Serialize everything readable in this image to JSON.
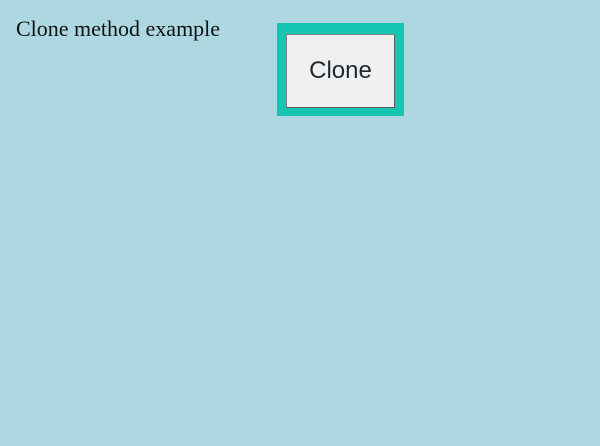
{
  "page": {
    "text": "Clone method example",
    "background_color": "#add8e1"
  },
  "button": {
    "label": "Clone",
    "frame_color": "#16c6b3"
  }
}
